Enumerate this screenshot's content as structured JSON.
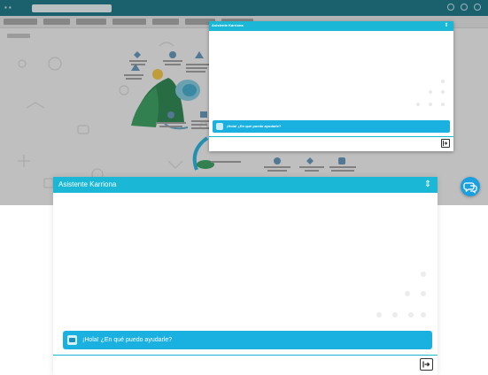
{
  "colors": {
    "accent": "#1ab8d6",
    "bubble": "#1ab0e0",
    "app_bar": "#0f6f80",
    "launcher": "#1a9fe0"
  },
  "small_chat": {
    "title": "Asistente Karriona",
    "toggle_icon": "chevron-icon",
    "greeting": "¡Hola! ¿En qué puedo ayudarle?",
    "send_icon": "send-icon"
  },
  "big_chat": {
    "title": "Asistente Karriona",
    "toggle_icon": "chevron-icon",
    "greeting": "¡Hola! ¿En qué puedo ayudarle?",
    "send_icon": "send-icon"
  },
  "launcher": {
    "icon": "chat-bubbles-icon"
  }
}
